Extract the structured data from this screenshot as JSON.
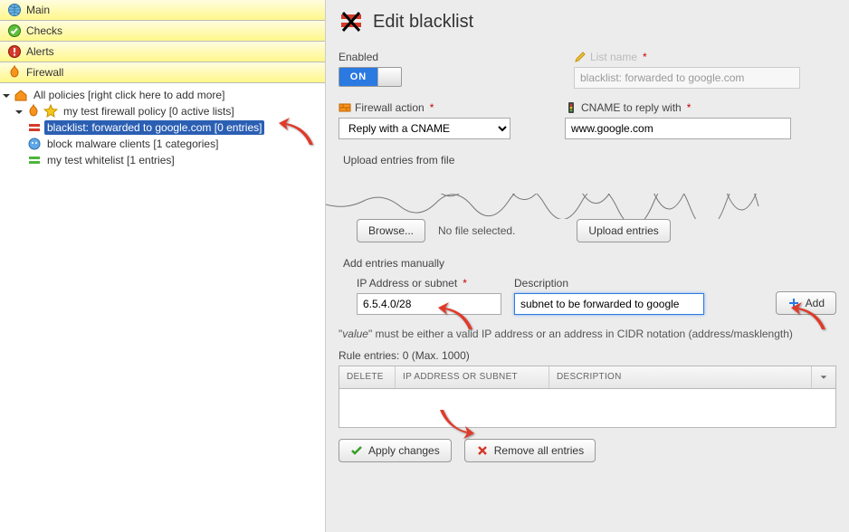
{
  "sidebar": {
    "sections": {
      "main": "Main",
      "checks": "Checks",
      "alerts": "Alerts",
      "firewall": "Firewall"
    },
    "tree": {
      "root": "All policies [right click here to add more]",
      "policy": "my test firewall policy [0 active lists]",
      "blacklist": "blacklist: forwarded to google.com [0 entries]",
      "malware": "block malware clients [1 categories]",
      "whitelist": "my test whitelist [1 entries]"
    }
  },
  "page": {
    "title": "Edit blacklist",
    "enabled_label": "Enabled",
    "toggle_on": "ON",
    "listname_label": "List name",
    "listname_value": "blacklist: forwarded to google.com",
    "firewall_action_label": "Firewall action",
    "firewall_action_value": "Reply with a CNAME",
    "cname_label": "CNAME to reply with",
    "cname_value": "www.google.com",
    "upload_title": "Upload entries from file",
    "browse_btn": "Browse...",
    "no_file": "No file selected.",
    "upload_btn": "Upload entries",
    "manual_title": "Add entries manually",
    "ip_label": "IP Address or subnet",
    "ip_value": "6.5.4.0/28",
    "desc_label": "Description",
    "desc_value": "subnet to be forwarded to google",
    "add_btn": "Add",
    "hint_prefix": "\"",
    "hint_value_word": "value",
    "hint_suffix": "\" must be either a valid IP address or an address in CIDR notation (address/masklength)",
    "rule_entries": "Rule entries: 0 (Max. 1000)",
    "col_delete": "DELETE",
    "col_ip": "IP ADDRESS OR SUBNET",
    "col_desc": "DESCRIPTION",
    "apply_btn": "Apply changes",
    "remove_btn": "Remove all entries"
  }
}
